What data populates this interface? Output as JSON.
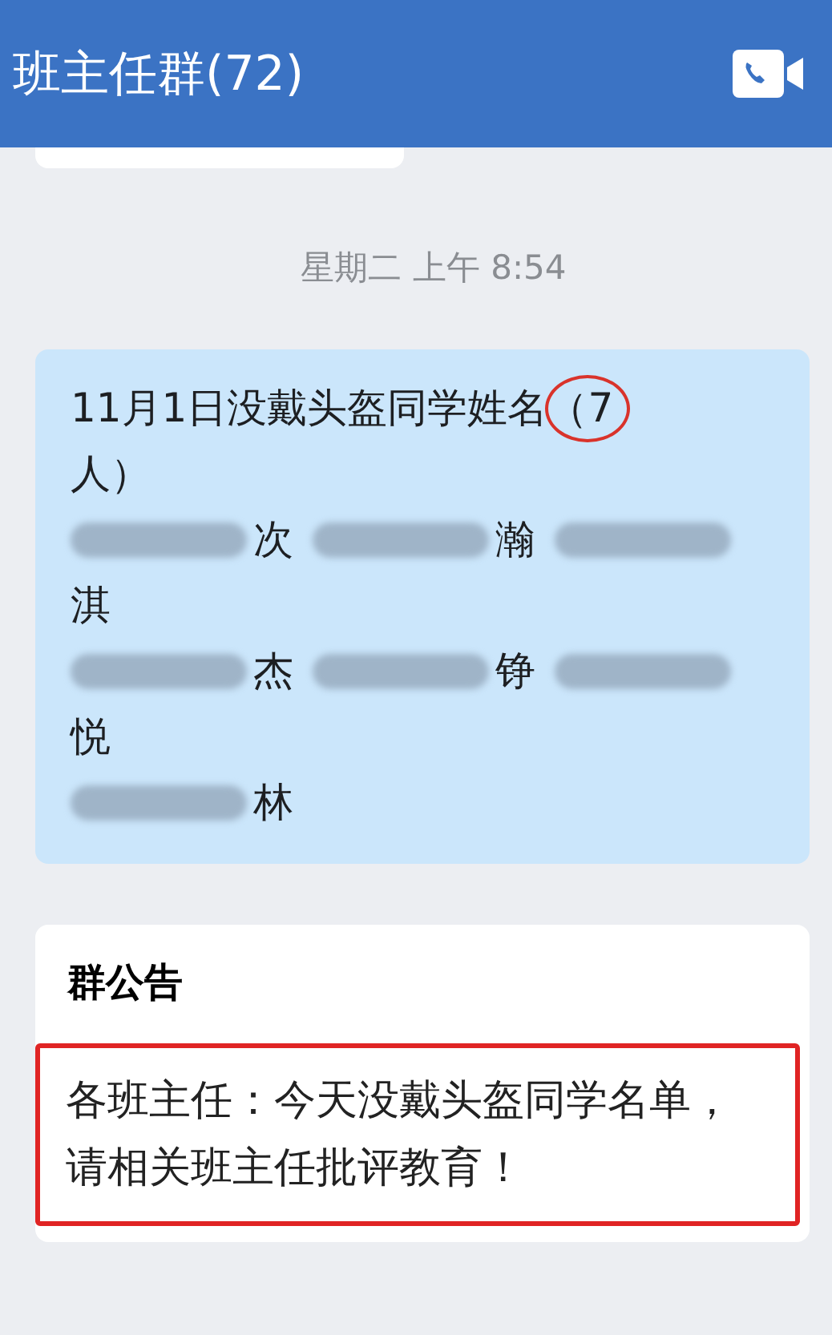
{
  "header": {
    "title": "班主任群(72)"
  },
  "timestamp": "星期二  上午 8:54",
  "message": {
    "title_start": "11月1日没戴头盔同学姓名",
    "circled": "（7",
    "title_end": "人）",
    "rows": [
      [
        {
          "kind": "blurred"
        },
        {
          "kind": "text",
          "text": "次"
        },
        {
          "kind": "blurred"
        },
        {
          "kind": "text",
          "text": "瀚"
        },
        {
          "kind": "blurred"
        }
      ],
      [
        {
          "kind": "text",
          "text": "淇"
        }
      ],
      [
        {
          "kind": "blurred"
        },
        {
          "kind": "text",
          "text": "杰"
        },
        {
          "kind": "blurred"
        },
        {
          "kind": "text",
          "text": "铮"
        },
        {
          "kind": "blurred"
        }
      ],
      [
        {
          "kind": "text",
          "text": "悦"
        }
      ],
      [
        {
          "kind": "blurred"
        },
        {
          "kind": "text",
          "text": "林"
        }
      ]
    ]
  },
  "announcement": {
    "title": "群公告",
    "text": "各班主任：今天没戴头盔同学名单，请相关班主任批评教育！"
  }
}
